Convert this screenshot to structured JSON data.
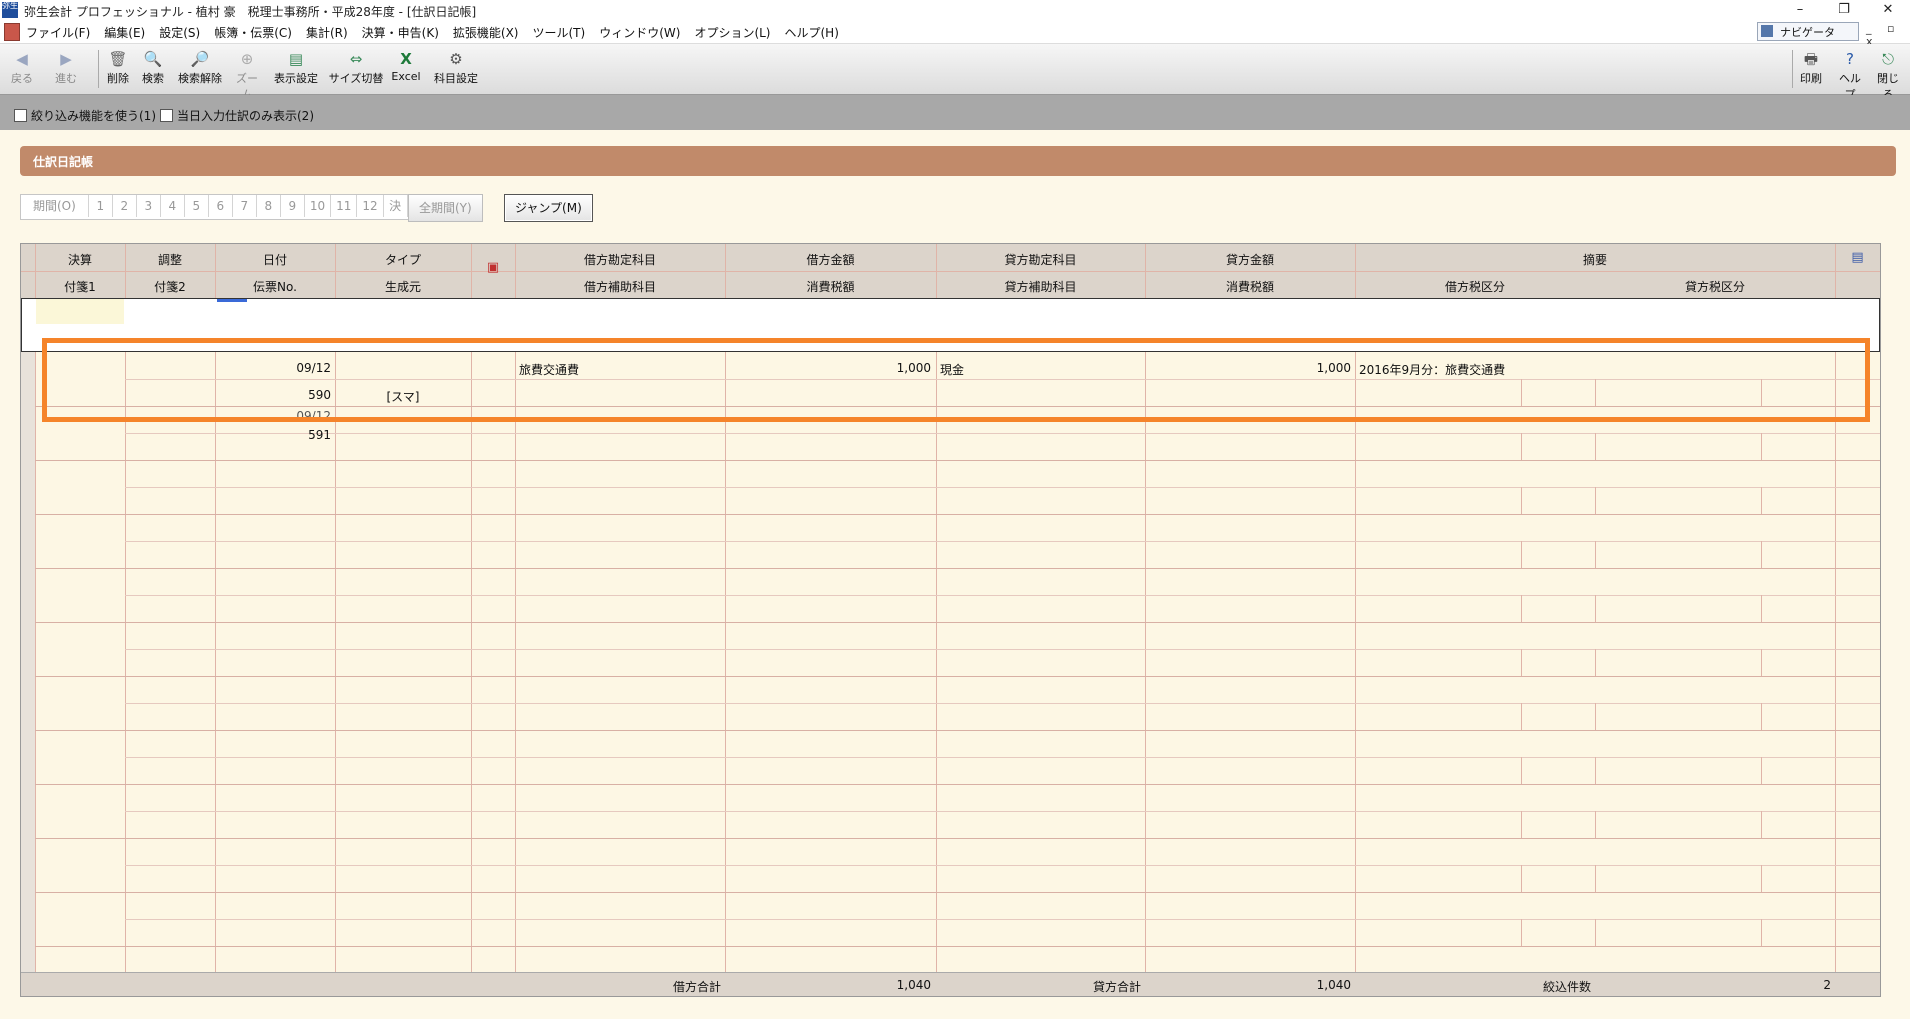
{
  "window": {
    "title": "弥生会計 プロフェッショナル - 植村 豪　税理士事務所・平成28年度 - [仕訳日記帳]",
    "app_icon": "弥生",
    "min_glyph": "–",
    "restore_glyph": "❐",
    "close_glyph": "✕"
  },
  "menu": {
    "items": [
      "ファイル(F)",
      "編集(E)",
      "設定(S)",
      "帳簿・伝票(C)",
      "集計(R)",
      "決算・申告(K)",
      "拡張機能(X)",
      "ツール(T)",
      "ウィンドウ(W)",
      "オプション(L)",
      "ヘルプ(H)"
    ],
    "navigator_label": "ナビゲータ",
    "mdi_controls": "_ ▫ x"
  },
  "toolbar": {
    "back": "戻る",
    "forward": "進む",
    "delete": "削除",
    "search": "検索",
    "search_clear": "検索解除",
    "zoom": "ズーム",
    "display_settings": "表示設定",
    "size_switch": "サイズ切替",
    "excel": "Excel",
    "account_settings": "科目設定",
    "print": "印刷",
    "help": "ヘルプ",
    "close": "閉じる"
  },
  "options": {
    "filter_label": "絞り込み機能を使う(1)",
    "today_only_label": "当日入力仕訳のみ表示(2)"
  },
  "panel": {
    "title": "仕訳日記帳",
    "period_label": "期間(O)",
    "months": [
      "1",
      "2",
      "3",
      "4",
      "5",
      "6",
      "7",
      "8",
      "9",
      "10",
      "11",
      "12",
      "決"
    ],
    "all_period_button": "全期間(Y)",
    "jump_button": "ジャンプ(M)"
  },
  "grid": {
    "header_top": {
      "settle": "決算",
      "adjust": "調整",
      "date": "日付",
      "type": "タイプ",
      "debit_account": "借方勘定科目",
      "debit_amount": "借方金額",
      "credit_account": "貸方勘定科目",
      "credit_amount": "貸方金額",
      "summary": "摘要"
    },
    "header_bottom": {
      "tag1": "付箋1",
      "tag2": "付箋2",
      "slip_no": "伝票No.",
      "origin": "生成元",
      "debit_sub": "借方補助科目",
      "debit_tax": "消費税額",
      "credit_sub": "貸方補助科目",
      "credit_tax": "消費税額",
      "debit_tax_class": "借方税区分",
      "credit_tax_class": "貸方税区分"
    },
    "rows": [
      {
        "date": "09/12",
        "slip_no": "590",
        "origin": "[スマ]",
        "debit_account": "旅費交通費",
        "debit_amount": "1,000",
        "credit_account": "現金",
        "credit_amount": "1,000",
        "summary": "2016年9月分：旅費交通費"
      },
      {
        "date": "09/12",
        "slip_no": "591"
      }
    ],
    "footer": {
      "debit_total_label": "借方合計",
      "debit_total": "1,040",
      "credit_total_label": "貸方合計",
      "credit_total": "1,040",
      "count_label": "絞込件数",
      "count": "2"
    }
  },
  "colors": {
    "header_bar": "#c18a6a",
    "grid_bg": "#fdf7e4",
    "highlight": "#f5842a"
  }
}
